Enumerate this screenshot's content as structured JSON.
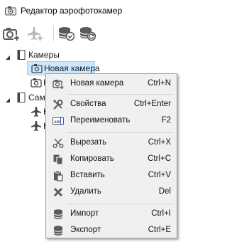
{
  "window": {
    "title": "Редактор аэрофотокамер",
    "app_icon": "camera-icon"
  },
  "toolbar": {
    "buttons": [
      {
        "name": "add-camera-button",
        "icon": "camera-add-icon"
      },
      {
        "name": "add-aircraft-button",
        "icon": "airplane-add-icon"
      },
      {
        "name": "save-database-button",
        "icon": "database-save-icon"
      },
      {
        "name": "refresh-database-button",
        "icon": "database-refresh-icon"
      }
    ]
  },
  "tree": {
    "cameras_group": "Камеры",
    "camera_new": "Новая камера",
    "camera_second": "Н",
    "aircraft_group": "Само",
    "aircraft_first": "Н",
    "aircraft_second": "Н"
  },
  "context_menu": {
    "items": [
      {
        "label": "Новая камера",
        "shortcut": "Ctrl+N",
        "icon": "camera-add-icon"
      },
      {
        "label": "Свойства",
        "shortcut": "Ctrl+Enter",
        "icon": "wrench-screwdriver-icon"
      },
      {
        "label": "Переименовать",
        "shortcut": "F2",
        "icon": "rename-icon"
      },
      {
        "label": "Вырезать",
        "shortcut": "Ctrl+X",
        "icon": "scissors-icon"
      },
      {
        "label": "Копировать",
        "shortcut": "Ctrl+C",
        "icon": "copy-icon"
      },
      {
        "label": "Вставить",
        "shortcut": "Ctrl+V",
        "icon": "paste-icon"
      },
      {
        "label": "Удалить",
        "shortcut": "Del",
        "icon": "delete-x-icon"
      },
      {
        "label": "Импорт",
        "shortcut": "Ctrl+I",
        "icon": "import-icon"
      },
      {
        "label": "Экспорт",
        "shortcut": "Ctrl+E",
        "icon": "export-icon"
      }
    ]
  },
  "colors": {
    "selection_bg": "#cce8ff",
    "selection_border": "#99d1ff",
    "menu_bg": "#f0f0f0",
    "icon_gray": "#5a5a5a"
  }
}
